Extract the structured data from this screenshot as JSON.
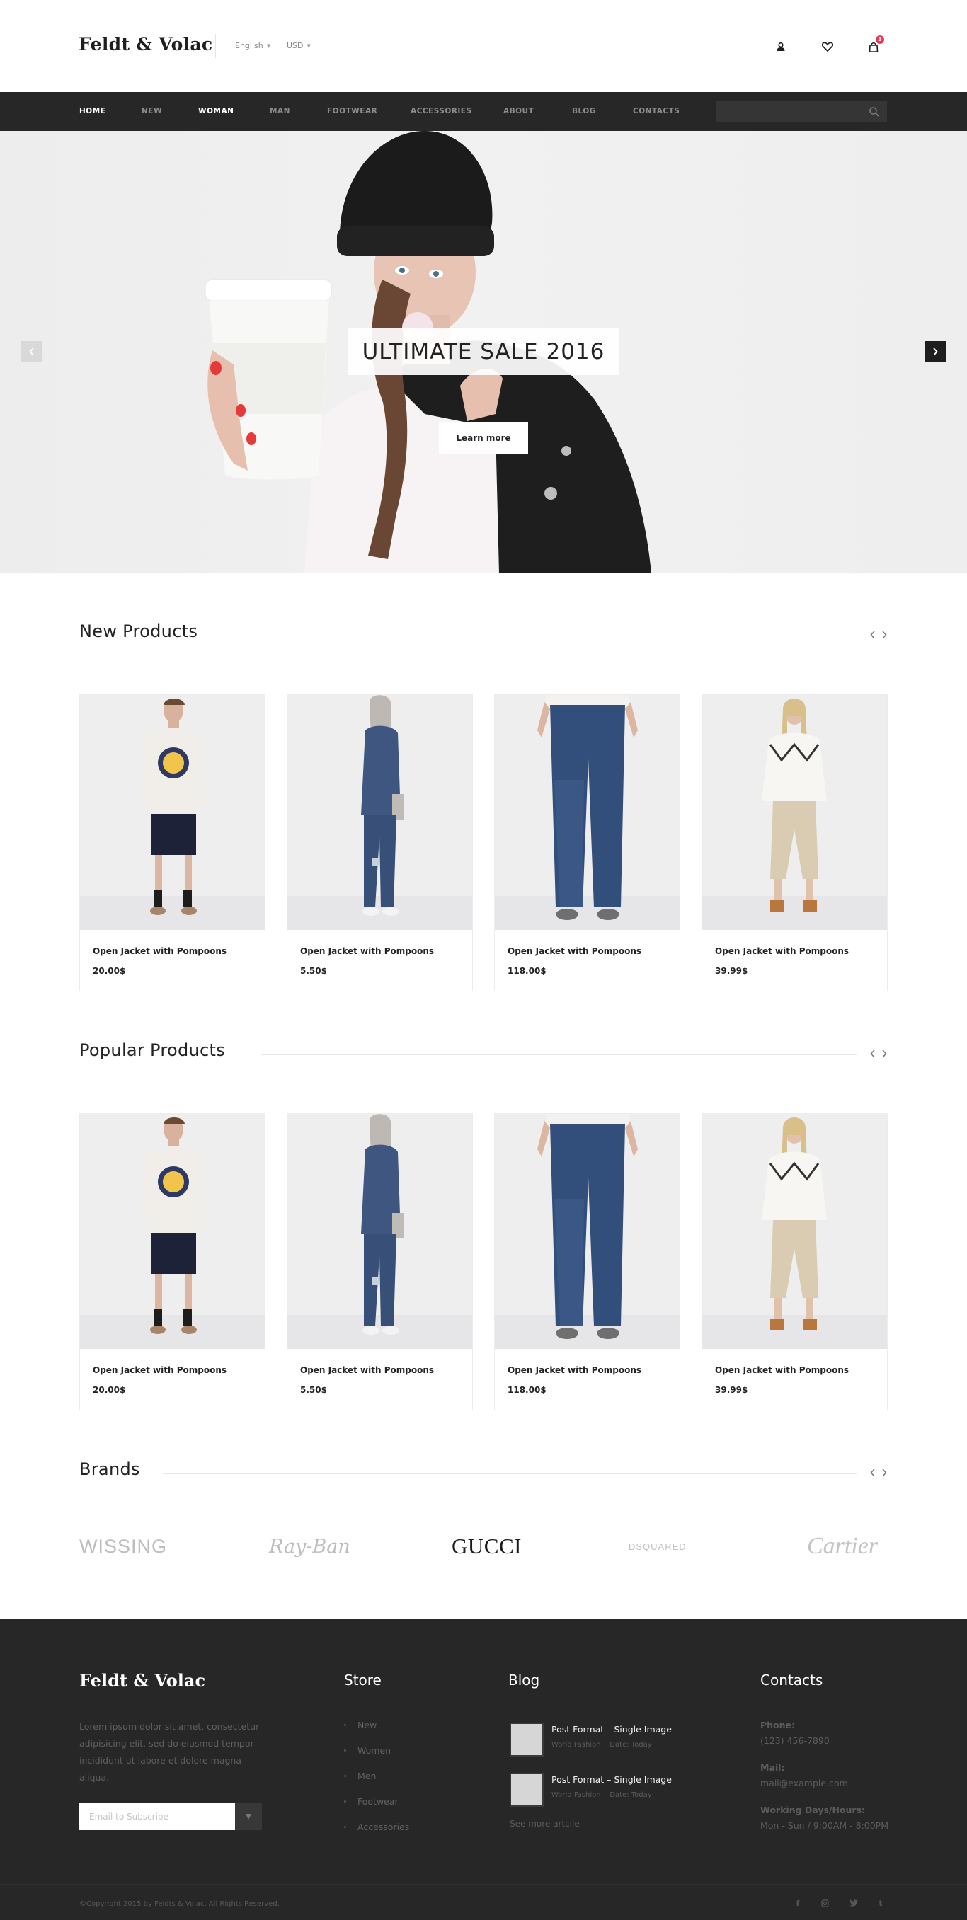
{
  "header": {
    "logo": "Feldt & Volac",
    "language": "English",
    "currency": "USD",
    "cart_count": "3"
  },
  "nav": {
    "items": [
      "HOME",
      "NEW",
      "WOMAN",
      "MAN",
      "FOOTWEAR",
      "ACCESSORIES",
      "ABOUT",
      "BLOG",
      "CONTACTS"
    ],
    "active": [
      "HOME",
      "WOMAN"
    ],
    "search_placeholder": ""
  },
  "hero": {
    "title": "ULTIMATE SALE 2016",
    "button": "Learn more"
  },
  "new_products": {
    "title": "New Products",
    "items": [
      {
        "name": "Open Jacket with Pompoons",
        "price": "20.00$"
      },
      {
        "name": "Open Jacket with Pompoons",
        "price": "5.50$"
      },
      {
        "name": "Open Jacket with Pompoons",
        "price": "118.00$"
      },
      {
        "name": "Open Jacket with Pompoons",
        "price": "39.99$"
      }
    ]
  },
  "popular_products": {
    "title": "Popular Products",
    "items": [
      {
        "name": "Open Jacket with Pompoons",
        "price": "20.00$"
      },
      {
        "name": "Open Jacket with Pompoons",
        "price": "5.50$"
      },
      {
        "name": "Open Jacket with Pompoons",
        "price": "118.00$"
      },
      {
        "name": "Open Jacket with Pompoons",
        "price": "39.99$"
      }
    ]
  },
  "brands": {
    "title": "Brands",
    "items": [
      "WISSING",
      "Ray-Ban",
      "GUCCI",
      "DSQUARED",
      "Cartier"
    ]
  },
  "footer": {
    "logo": "Feldt & Volac",
    "about": "Lorem ipsum dolor sit amet, consectetur adipisicing elit, sed do eiusmod tempor incididunt ut labore et dolore magna aliqua.",
    "subscribe_placeholder": "Email to Subscribe",
    "store": {
      "title": "Store",
      "items": [
        "New",
        "Women",
        "Men",
        "Footwear",
        "Accessories"
      ]
    },
    "blog": {
      "title": "Blog",
      "posts": [
        {
          "title": "Post Format – Single Image",
          "category": "World Fashion",
          "date": "Date: Today"
        },
        {
          "title": "Post Format – Single Image",
          "category": "World Fashion",
          "date": "Date: Today"
        }
      ],
      "see_more": "See more artcile"
    },
    "contacts": {
      "title": "Contacts",
      "phone_label": "Phone:",
      "phone": "(123) 456-7890",
      "mail_label": "Mail:",
      "mail": "mail@example.com",
      "hours_label": "Working Days/Hours:",
      "hours": "Mon - Sun / 9:00AM - 8:00PM"
    },
    "copyright": "©Copyright 2015 by Feldts & Volac. All Rights Reserved.",
    "social": [
      "facebook-icon",
      "instagram-icon",
      "twitter-icon",
      "tumblr-icon"
    ]
  }
}
